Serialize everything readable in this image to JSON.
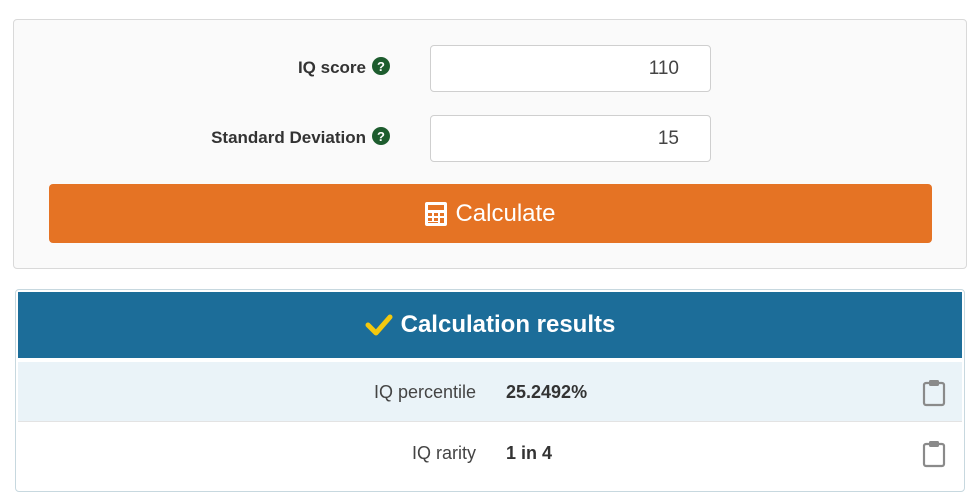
{
  "form": {
    "fields": [
      {
        "label": "IQ score",
        "value": "110",
        "help_icon": "question-circle-icon"
      },
      {
        "label": "Standard Deviation",
        "value": "15",
        "help_icon": "question-circle-icon"
      }
    ],
    "calculate_label": "Calculate",
    "calculate_icon": "calculator-icon",
    "button_color": "#e57324"
  },
  "results": {
    "title": "Calculation results",
    "title_icon": "checkmark-icon",
    "header_color": "#1c6d99",
    "check_color": "#f3c80e",
    "rows": [
      {
        "label": "IQ percentile",
        "value": "25.2492%",
        "copy_icon": "clipboard-icon"
      },
      {
        "label": "IQ rarity",
        "value": "1 in 4",
        "copy_icon": "clipboard-icon"
      }
    ]
  },
  "help_icon_glyph": "?"
}
